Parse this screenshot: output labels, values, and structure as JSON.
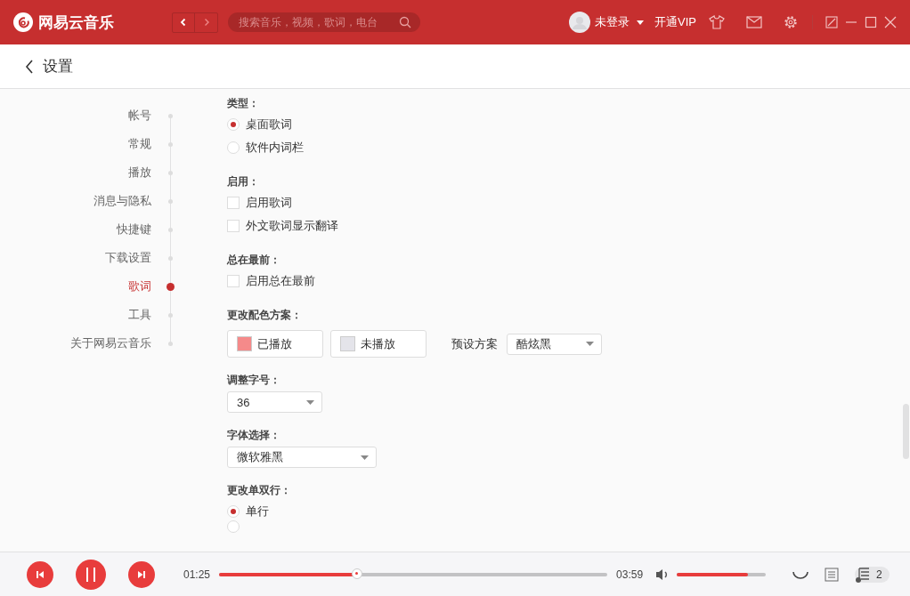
{
  "app": {
    "name": "网易云音乐"
  },
  "search": {
    "placeholder": "搜索音乐，视频，歌词，电台"
  },
  "user": {
    "name": "未登录",
    "vip": "开通VIP"
  },
  "page": {
    "title": "设置"
  },
  "nav": [
    {
      "label": "帐号",
      "selected": false
    },
    {
      "label": "常规",
      "selected": false
    },
    {
      "label": "播放",
      "selected": false
    },
    {
      "label": "消息与隐私",
      "selected": false
    },
    {
      "label": "快捷键",
      "selected": false
    },
    {
      "label": "下载设置",
      "selected": false
    },
    {
      "label": "歌词",
      "selected": true
    },
    {
      "label": "工具",
      "selected": false
    },
    {
      "label": "关于网易云音乐",
      "selected": false
    }
  ],
  "sections": [
    {
      "kind": "radio",
      "title": "类型：",
      "options": [
        {
          "label": "桌面歌词",
          "selected": true
        },
        {
          "label": "软件内词栏",
          "selected": false
        }
      ]
    },
    {
      "kind": "checkbox",
      "title": "启用：",
      "options": [
        {
          "label": "启用歌词",
          "checked": false
        },
        {
          "label": "外文歌词显示翻译",
          "checked": false
        }
      ]
    },
    {
      "kind": "checkbox",
      "title": "总在最前：",
      "options": [
        {
          "label": "启用总在最前",
          "checked": false
        }
      ]
    },
    {
      "kind": "colors",
      "title": "更改配色方案：",
      "swatches": [
        {
          "label": "已播放",
          "color": "#f58a8a"
        },
        {
          "label": "未播放",
          "color": "#e4e4ea"
        }
      ],
      "preset_label": "预设方案",
      "preset": "酷炫黑"
    },
    {
      "kind": "select",
      "title": "调整字号：",
      "value": "36"
    },
    {
      "kind": "select",
      "title": "字体选择：",
      "value": "微软雅黑"
    },
    {
      "kind": "radio",
      "title": "更改单双行：",
      "options": [
        {
          "label": "单行",
          "selected": true
        },
        {
          "selected": false
        }
      ]
    }
  ],
  "player": {
    "elapsed": "01:25",
    "total": "03:59",
    "level": 0.355,
    "volume": {
      "level": 0.8
    },
    "queue_count": "2"
  }
}
